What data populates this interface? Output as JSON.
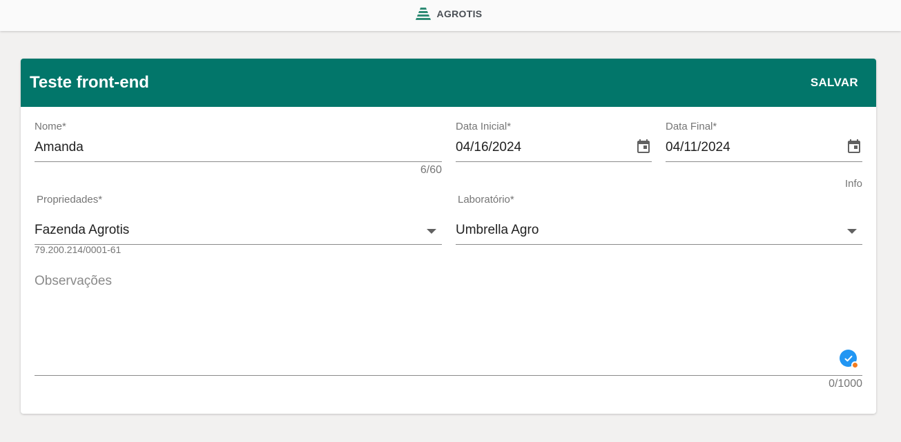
{
  "app": {
    "brand": "AGROTIS"
  },
  "form": {
    "title": "Teste front-end",
    "save_label": "SALVAR",
    "nome": {
      "label": "Nome*",
      "value": "Amanda",
      "counter": "6/60"
    },
    "data_inicial": {
      "label": "Data Inicial*",
      "value": "04/16/2024"
    },
    "data_final": {
      "label": "Data Final*",
      "value": "04/11/2024"
    },
    "info": "Info",
    "propriedades": {
      "label": "Propriedades*",
      "value": "Fazenda Agrotis",
      "hint": "79.200.214/0001-61"
    },
    "laboratorio": {
      "label": "Laboratório*",
      "value": "Umbrella Agro"
    },
    "observacoes": {
      "label": "Observações",
      "value": "",
      "counter": "0/1000"
    }
  },
  "colors": {
    "header": "#02766a",
    "background": "#f2f1f0",
    "badge": "#2196f3",
    "badge_dot": "#f57c1f"
  },
  "icons": [
    "agrotis-logo-icon",
    "calendar-icon",
    "dropdown-arrow-icon",
    "checkmark-badge-icon"
  ]
}
